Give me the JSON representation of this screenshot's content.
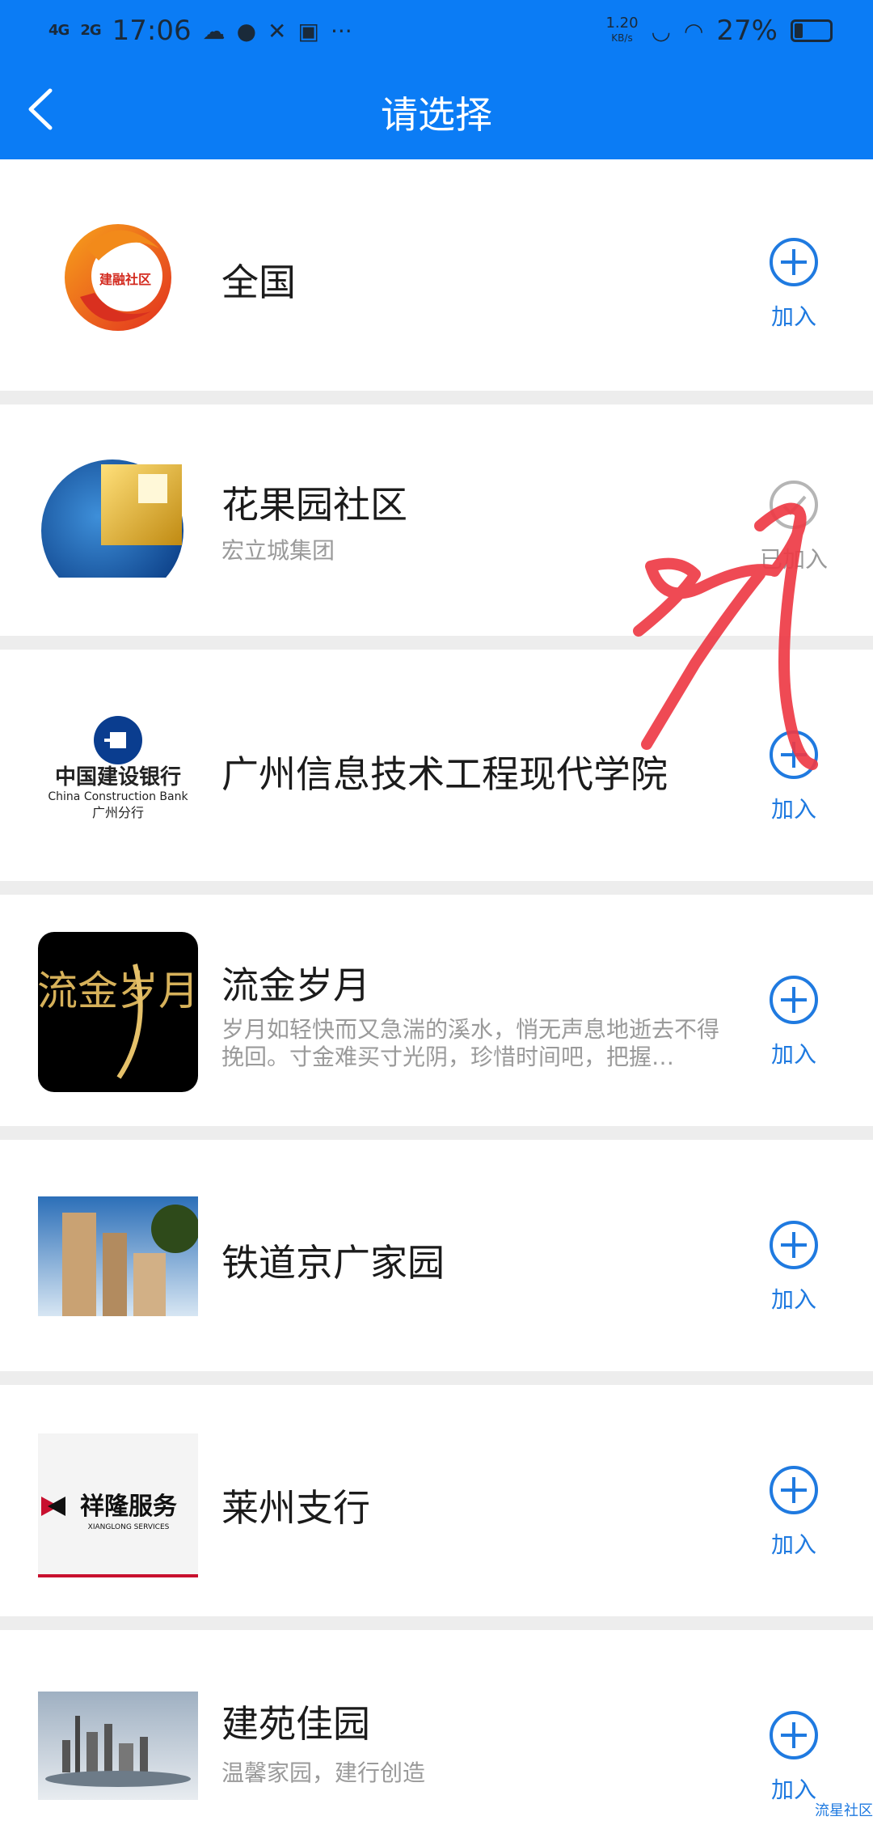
{
  "status_bar": {
    "network1": "4G",
    "network2": "2G",
    "time": "17:06",
    "speed_value": "1.20",
    "speed_unit": "KB/s",
    "battery": "27%"
  },
  "header": {
    "title": "请选择"
  },
  "items": [
    {
      "name": "全国",
      "subtitle": "",
      "action": "加入",
      "joined": false
    },
    {
      "name": "花果园社区",
      "subtitle": "宏立城集团",
      "action": "已加入",
      "joined": true
    },
    {
      "name": "广州信息技术工程现代学院",
      "subtitle": "",
      "action": "加入",
      "joined": false
    },
    {
      "name": "流金岁月",
      "subtitle": "岁月如轻快而又急湍的溪水，悄无声息地逝去不得挽回。寸金难买寸光阴，珍惜时间吧，把握…",
      "action": "加入",
      "joined": false
    },
    {
      "name": "铁道京广家园",
      "subtitle": "",
      "action": "加入",
      "joined": false
    },
    {
      "name": "莱州支行",
      "subtitle": "",
      "action": "加入",
      "joined": false
    },
    {
      "name": "建苑佳园",
      "subtitle": "温馨家园，建行创造",
      "action": "加入",
      "joined": false
    }
  ],
  "logo_text": {
    "jianrong": "建融社区",
    "ccb_cn": "中国建设银行",
    "ccb_en": "China Construction Bank",
    "ccb_branch": "广州分行",
    "liujin": "流金岁月",
    "xianglong": "祥隆服务",
    "xianglong_en": "XIANGLONG SERVICES"
  },
  "watermark": "流星社区",
  "colors": {
    "accent": "#0b7cf5",
    "action_blue": "#1f7ae0",
    "annotation_red": "#ee3b46"
  }
}
